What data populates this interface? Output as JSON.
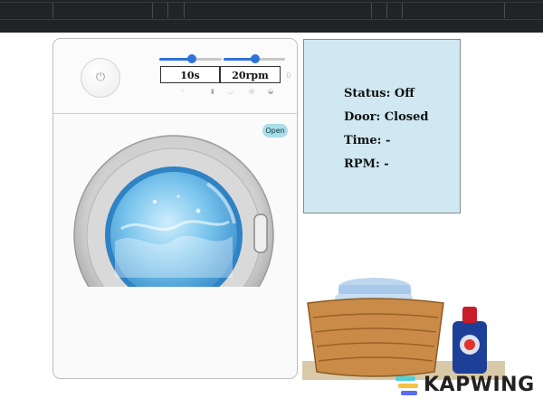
{
  "washer": {
    "power_symbol": "⏻",
    "time_readout": "10s",
    "speed_readout": "20rpm",
    "time_slider_level_percent": 52,
    "speed_slider_level_percent": 52,
    "open_label": "Open",
    "panel_icons": [
      "clock-icon",
      "thermometer-icon",
      "basket-icon",
      "spin-icon",
      "drop-icon"
    ],
    "side_icon": "bin-icon"
  },
  "status_panel": {
    "status": "Status: Off",
    "door": "Door: Closed",
    "time": "Time: -",
    "rpm": "RPM: -"
  },
  "watermark": {
    "text": "KAPWING"
  },
  "colors": {
    "accent": "#2f73d8",
    "status_bg": "#cfe8f2",
    "open_button": "#a9dde8",
    "water": "#64b8e8"
  }
}
